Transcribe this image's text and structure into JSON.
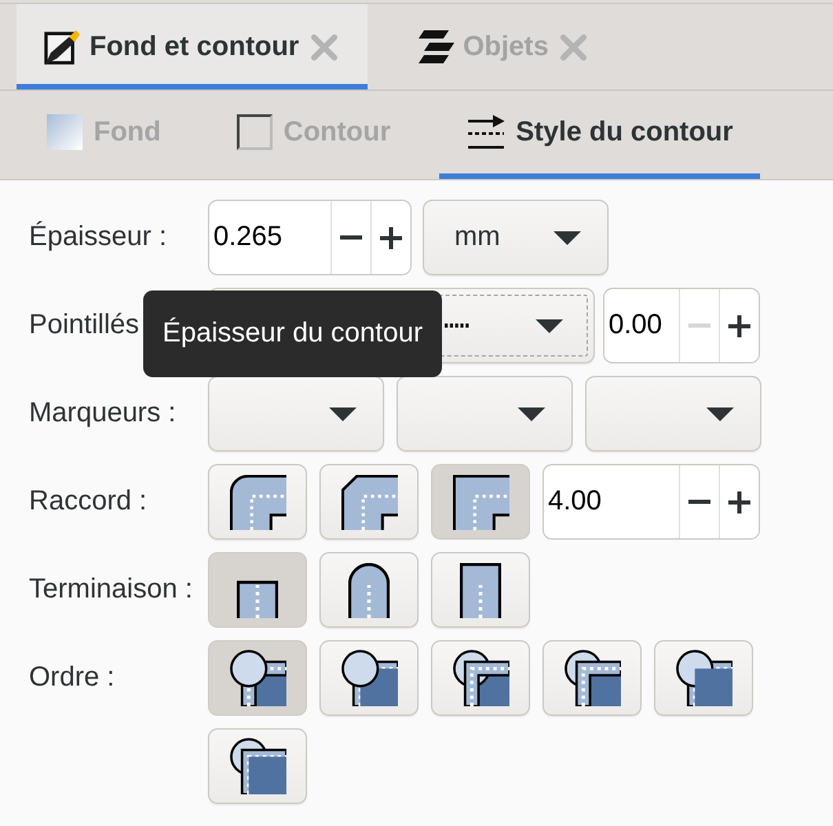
{
  "tabs": [
    {
      "label": "Fond et contour",
      "selected": true
    },
    {
      "label": "Objets",
      "selected": false
    }
  ],
  "subtabs": [
    {
      "label": "Fond",
      "selected": false
    },
    {
      "label": "Contour",
      "selected": false
    },
    {
      "label": "Style du contour",
      "selected": true
    }
  ],
  "rows": [
    {
      "kind": "width",
      "label": "Épaisseur :",
      "controls": [
        {
          "kind": "spin",
          "value": "0.265",
          "minus_disabled": false
        },
        {
          "kind": "dropdown",
          "value": "mm"
        }
      ]
    },
    {
      "kind": "dash",
      "label": "Pointillés",
      "controls": [
        {
          "kind": "dash",
          "focused": true
        },
        {
          "kind": "spin",
          "value": "0.00",
          "minus_disabled": true
        }
      ]
    },
    {
      "kind": "markers",
      "label": "Marqueurs :",
      "controls": [
        {
          "kind": "dropdown"
        },
        {
          "kind": "dropdown"
        },
        {
          "kind": "dropdown"
        }
      ]
    },
    {
      "kind": "join",
      "label": "Raccord :",
      "controls": [
        {
          "kind": "toggle",
          "selected": false
        },
        {
          "kind": "toggle",
          "selected": false
        },
        {
          "kind": "toggle",
          "selected": true
        },
        {
          "kind": "spin",
          "value": "4.00",
          "minus_disabled": false
        }
      ]
    },
    {
      "kind": "cap",
      "label": "Terminaison :",
      "controls": [
        {
          "kind": "toggle",
          "selected": true
        },
        {
          "kind": "toggle",
          "selected": false
        },
        {
          "kind": "toggle",
          "selected": false
        }
      ]
    },
    {
      "kind": "order",
      "label": "Ordre :",
      "controls": [
        {
          "kind": "toggle",
          "selected": true
        },
        {
          "kind": "toggle",
          "selected": false
        },
        {
          "kind": "toggle",
          "selected": false
        },
        {
          "kind": "toggle",
          "selected": false
        },
        {
          "kind": "toggle",
          "selected": false
        },
        {
          "kind": "toggle",
          "selected": false
        }
      ]
    }
  ],
  "tooltip": {
    "text": "Épaisseur du contour"
  }
}
